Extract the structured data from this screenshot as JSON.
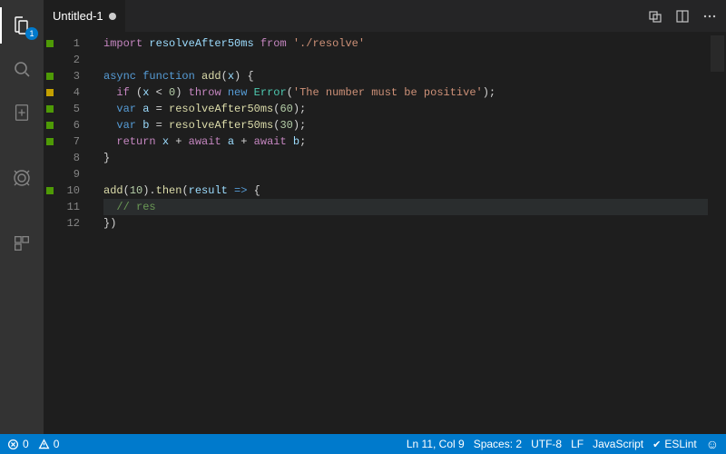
{
  "activity": {
    "explorer_badge": "1"
  },
  "tab": {
    "title": "Untitled-1"
  },
  "code": {
    "line_count": 12,
    "gutter_marks": {
      "1": "green",
      "3": "green",
      "4": "yellow",
      "5": "green",
      "6": "green",
      "7": "green",
      "10": "green"
    },
    "lines": {
      "l1_import": "import",
      "l1_ident": " resolveAfter50ms ",
      "l1_from": "from",
      "l1_str": " './resolve'",
      "l3_async": "async",
      "l3_func": " function",
      "l3_name": " add",
      "l3_paren_open": "(",
      "l3_param": "x",
      "l3_rest": ") {",
      "l4_indent": "  ",
      "l4_if": "if",
      "l4_cond_open": " (",
      "l4_x": "x",
      "l4_op": " < ",
      "l4_zero": "0",
      "l4_cond_close": ") ",
      "l4_throw": "throw",
      "l4_new": " new",
      "l4_err": " Error",
      "l4_open": "(",
      "l4_msg": "'The number must be positive'",
      "l4_close": ");",
      "l5_indent": "  ",
      "l5_var": "var",
      "l5_a": " a",
      "l5_eq": " = ",
      "l5_fn": "resolveAfter50ms",
      "l5_open": "(",
      "l5_num": "60",
      "l5_close": ");",
      "l6_indent": "  ",
      "l6_var": "var",
      "l6_b": " b",
      "l6_eq": " = ",
      "l6_fn": "resolveAfter50ms",
      "l6_open": "(",
      "l6_num": "30",
      "l6_close": ");",
      "l7_indent": "  ",
      "l7_return": "return",
      "l7_x": " x",
      "l7_plus1": " + ",
      "l7_await1": "await",
      "l7_a": " a",
      "l7_plus2": " + ",
      "l7_await2": "await",
      "l7_b": " b",
      "l7_semi": ";",
      "l8": "}",
      "l10_fn": "add",
      "l10_open": "(",
      "l10_num": "10",
      "l10_close": ").",
      "l10_then": "then",
      "l10_open2": "(",
      "l10_param": "result",
      "l10_arrow": " =>",
      "l10_brace": " {",
      "l11_indent": "  ",
      "l11_cmt": "// res",
      "l12": "})"
    }
  },
  "status": {
    "errors": "0",
    "warnings": "0",
    "cursor": "Ln 11, Col 9",
    "spaces": "Spaces: 2",
    "encoding": "UTF-8",
    "eol": "LF",
    "language": "JavaScript",
    "eslint": "ESLint"
  }
}
